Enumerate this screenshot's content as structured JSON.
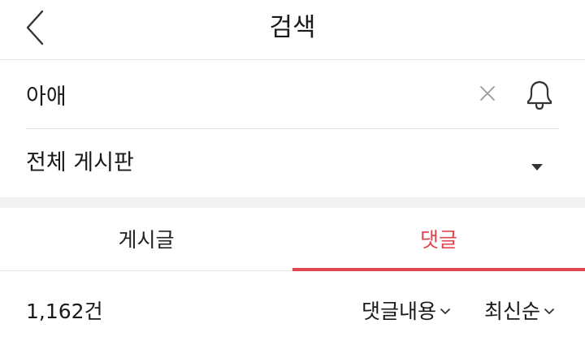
{
  "header": {
    "title": "검색"
  },
  "search": {
    "query": "아애"
  },
  "board": {
    "selected": "전체 게시판"
  },
  "tabs": [
    {
      "label": "게시글",
      "active": false
    },
    {
      "label": "댓글",
      "active": true
    }
  ],
  "results": {
    "count_text": "1,162건",
    "target_filter": "댓글내용",
    "sort_filter": "최신순"
  },
  "colors": {
    "accent": "#e0464f",
    "divider": "#e6e6e6",
    "gap": "#f2f2f2",
    "icon": "#333333"
  },
  "icons": {
    "back": "chevron-left-icon",
    "clear": "close-icon",
    "alert": "bell-icon",
    "board_dropdown": "caret-down-icon",
    "filter_dropdown": "chevron-down-icon"
  }
}
